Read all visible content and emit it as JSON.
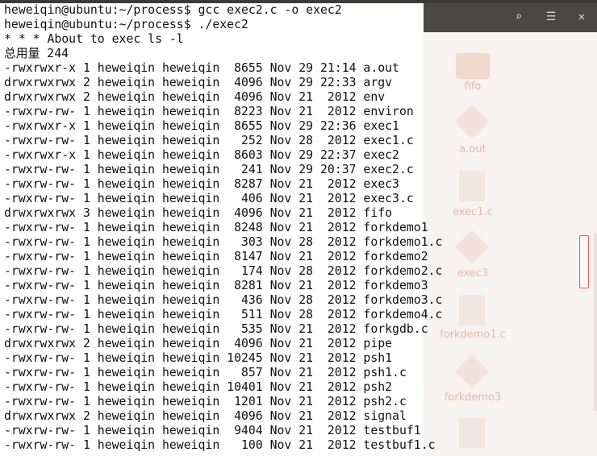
{
  "terminal": {
    "lines": [
      "heweiqin@ubuntu:~/process$ gcc exec2.c -o exec2",
      "heweiqin@ubuntu:~/process$ ./exec2",
      "* * * About to exec ls -l",
      "总用量 244",
      "-rwxrwxr-x 1 heweiqin heweiqin  8655 Nov 29 21:14 a.out",
      "drwxrwxrwx 2 heweiqin heweiqin  4096 Nov 29 22:33 argv",
      "drwxrwxrwx 2 heweiqin heweiqin  4096 Nov 21  2012 env",
      "-rwxrw-rw- 1 heweiqin heweiqin  8223 Nov 21  2012 environ",
      "-rwxrwxr-x 1 heweiqin heweiqin  8655 Nov 29 22:36 exec1",
      "-rwxrw-rw- 1 heweiqin heweiqin   252 Nov 28  2012 exec1.c",
      "-rwxrwxr-x 1 heweiqin heweiqin  8603 Nov 29 22:37 exec2",
      "-rwxrw-rw- 1 heweiqin heweiqin   241 Nov 29 20:37 exec2.c",
      "-rwxrw-rw- 1 heweiqin heweiqin  8287 Nov 21  2012 exec3",
      "-rwxrw-rw- 1 heweiqin heweiqin   406 Nov 21  2012 exec3.c",
      "drwxrwxrwx 3 heweiqin heweiqin  4096 Nov 21  2012 fifo",
      "-rwxrw-rw- 1 heweiqin heweiqin  8248 Nov 21  2012 forkdemo1",
      "-rwxrw-rw- 1 heweiqin heweiqin   303 Nov 28  2012 forkdemo1.c",
      "-rwxrw-rw- 1 heweiqin heweiqin  8147 Nov 21  2012 forkdemo2",
      "-rwxrw-rw- 1 heweiqin heweiqin   174 Nov 28  2012 forkdemo2.c",
      "-rwxrw-rw- 1 heweiqin heweiqin  8281 Nov 21  2012 forkdemo3",
      "-rwxrw-rw- 1 heweiqin heweiqin   436 Nov 28  2012 forkdemo3.c",
      "-rwxrw-rw- 1 heweiqin heweiqin   511 Nov 28  2012 forkdemo4.c",
      "-rwxrw-rw- 1 heweiqin heweiqin   535 Nov 21  2012 forkgdb.c",
      "drwxrwxrwx 2 heweiqin heweiqin  4096 Nov 21  2012 pipe",
      "-rwxrw-rw- 1 heweiqin heweiqin 10245 Nov 21  2012 psh1",
      "-rwxrw-rw- 1 heweiqin heweiqin   857 Nov 21  2012 psh1.c",
      "-rwxrw-rw- 1 heweiqin heweiqin 10401 Nov 21  2012 psh2",
      "-rwxrw-rw- 1 heweiqin heweiqin  1201 Nov 21  2012 psh2.c",
      "drwxrwxrwx 2 heweiqin heweiqin  4096 Nov 21  2012 signal",
      "-rwxrw-rw- 1 heweiqin heweiqin  9404 Nov 21  2012 testbuf1",
      "-rwxrw-rw- 1 heweiqin heweiqin   100 Nov 21  2012 testbuf1.c"
    ]
  },
  "desktop": {
    "labels": [
      "fifo",
      "a.out",
      "exec1.c",
      "exec3",
      "forkdemo1.c",
      "forkdemo3"
    ]
  }
}
